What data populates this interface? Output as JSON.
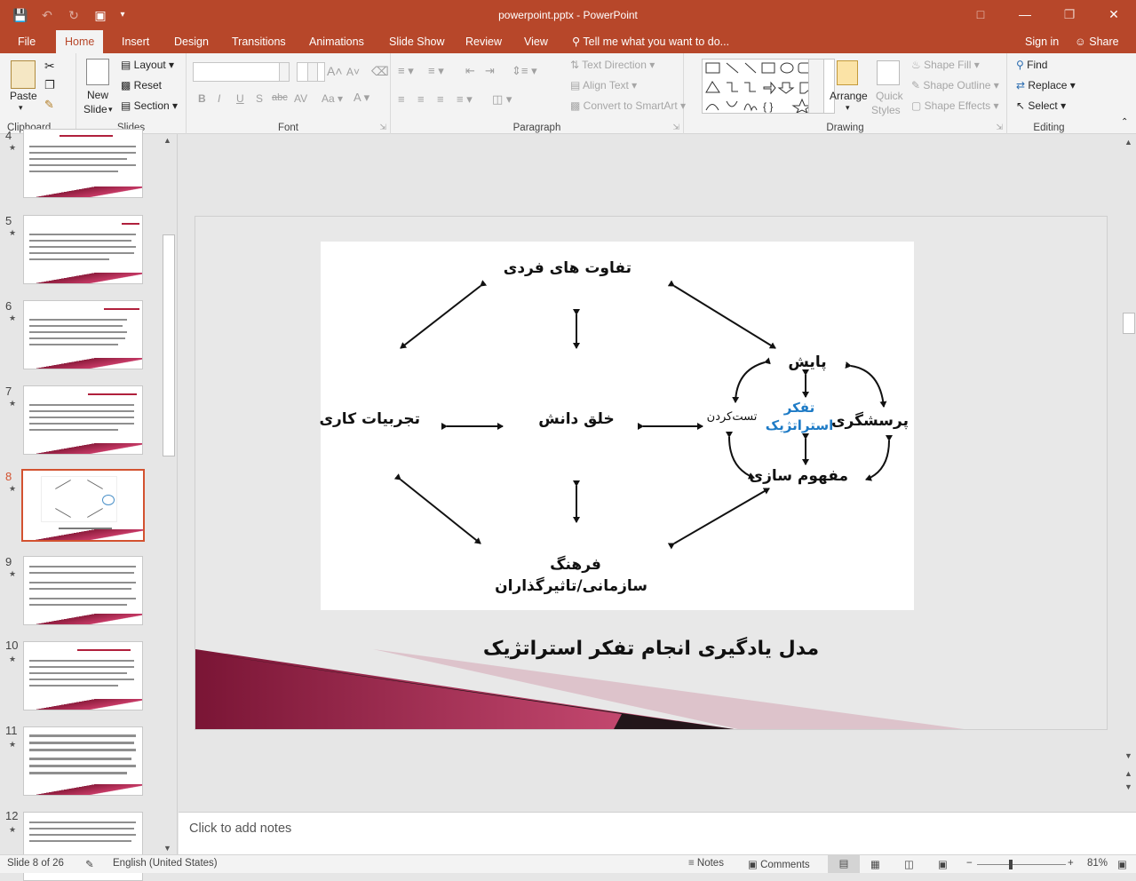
{
  "window": {
    "title": "powerpoint.pptx - PowerPoint"
  },
  "tabs": {
    "file": "File",
    "home": "Home",
    "insert": "Insert",
    "design": "Design",
    "transitions": "Transitions",
    "animations": "Animations",
    "slideshow": "Slide Show",
    "review": "Review",
    "view": "View",
    "tellme": "Tell me what you want to do...",
    "signin": "Sign in",
    "share": "Share"
  },
  "ribbon": {
    "clipboard": {
      "label": "Clipboard",
      "paste": "Paste"
    },
    "slides": {
      "label": "Slides",
      "new_slide_1": "New",
      "new_slide_2": "Slide",
      "layout": "Layout",
      "reset": "Reset",
      "section": "Section"
    },
    "font": {
      "label": "Font"
    },
    "paragraph": {
      "label": "Paragraph",
      "text_direction": "Text Direction",
      "align_text": "Align Text",
      "convert": "Convert to SmartArt"
    },
    "drawing": {
      "label": "Drawing",
      "arrange": "Arrange",
      "quick_1": "Quick",
      "quick_2": "Styles",
      "shape_fill": "Shape Fill",
      "shape_outline": "Shape Outline",
      "shape_effects": "Shape Effects"
    },
    "editing": {
      "label": "Editing",
      "find": "Find",
      "replace": "Replace",
      "select": "Select"
    }
  },
  "thumbnails": [
    {
      "num": "4"
    },
    {
      "num": "5"
    },
    {
      "num": "6"
    },
    {
      "num": "7"
    },
    {
      "num": "8",
      "selected": true
    },
    {
      "num": "9"
    },
    {
      "num": "10"
    },
    {
      "num": "11"
    },
    {
      "num": "12"
    }
  ],
  "slide": {
    "title": "مدل یادگیری انجام تفکر استراتژیک",
    "diagram": {
      "top": "تفاوت های فردی",
      "left": "تجربیات کاری",
      "center": "خلق دانش",
      "bottom_1": "فرهنگ",
      "bottom_2": "سازمانی/تاثیرگذاران",
      "monitor": "پایش",
      "test": "تست‌کردن",
      "strategic_1": "تفکر",
      "strategic_2": "استراتژیک",
      "questioning": "پرسشگری",
      "concept": "مفهوم سازی"
    }
  },
  "notes": {
    "placeholder": "Click to add notes"
  },
  "status": {
    "slide": "Slide 8 of 26",
    "language": "English (United States)",
    "notes": "Notes",
    "comments": "Comments",
    "zoom": "81%"
  }
}
